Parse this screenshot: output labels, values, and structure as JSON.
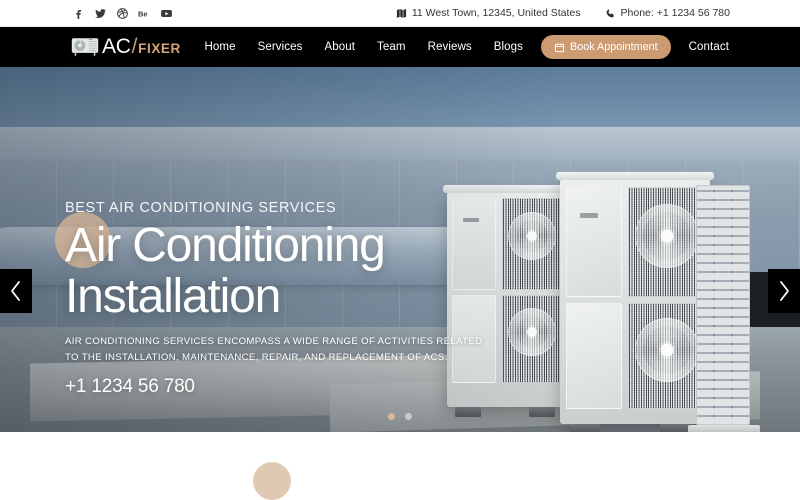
{
  "topbar": {
    "social": [
      {
        "name": "facebook-icon",
        "label": "f"
      },
      {
        "name": "twitter-icon",
        "label": "t"
      },
      {
        "name": "dribbble-icon",
        "label": "d"
      },
      {
        "name": "behance-icon",
        "label": "Be"
      },
      {
        "name": "youtube-icon",
        "label": "yt"
      }
    ],
    "address": "11 West Town, 12345, United States",
    "phone": "Phone: +1 1234 56 780"
  },
  "header": {
    "logo": {
      "ac": "AC",
      "slash": "/",
      "fixer": "FIXER"
    },
    "nav": [
      "Home",
      "Services",
      "About",
      "Team",
      "Reviews",
      "Blogs"
    ],
    "appointment_button": "Book Appointment",
    "contact": "Contact"
  },
  "hero": {
    "eyebrow": "BEST AIR CONDITIONING SERVICES",
    "title_line1": "Air Conditioning",
    "title_line2": "Installation",
    "description_line1": "AIR CONDITIONING SERVICES ENCOMPASS A WIDE RANGE OF ACTIVITIES RELATED",
    "description_line2": "TO THE INSTALLATION, MAINTENANCE, REPAIR, AND REPLACEMENT OF ACS.",
    "phone": "+1 1234 56 780",
    "prev_arrow": "‹",
    "next_arrow": "›",
    "slides": 2,
    "active_slide": 1
  },
  "colors": {
    "accent": "#cd9b72",
    "accent_light": "#d5b496",
    "header_bg": "#000000",
    "text_dark": "#333333"
  }
}
